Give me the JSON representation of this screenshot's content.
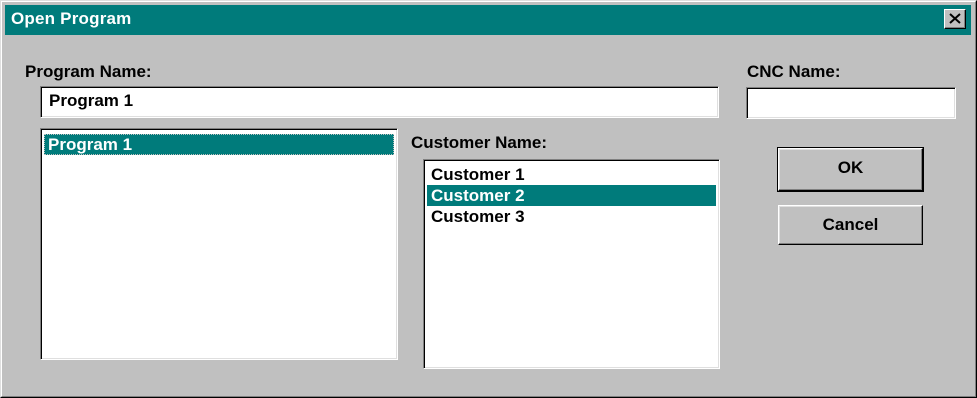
{
  "window": {
    "title": "Open Program"
  },
  "program_name": {
    "label": "Program Name:",
    "value": "Program 1"
  },
  "cnc_name": {
    "label": "CNC Name:",
    "value": ""
  },
  "program_list": {
    "items": [
      {
        "label": "Program 1",
        "selected": true
      }
    ]
  },
  "customer": {
    "label": "Customer Name:",
    "items": [
      {
        "label": "Customer 1",
        "selected": false
      },
      {
        "label": "Customer 2",
        "selected": true
      },
      {
        "label": "Customer 3",
        "selected": false
      }
    ]
  },
  "buttons": {
    "ok": "OK",
    "cancel": "Cancel"
  },
  "colors": {
    "titlebar": "#007b7b",
    "selection": "#007b7b",
    "face": "#c0c0c0"
  },
  "icons": {
    "close": "close-icon"
  }
}
